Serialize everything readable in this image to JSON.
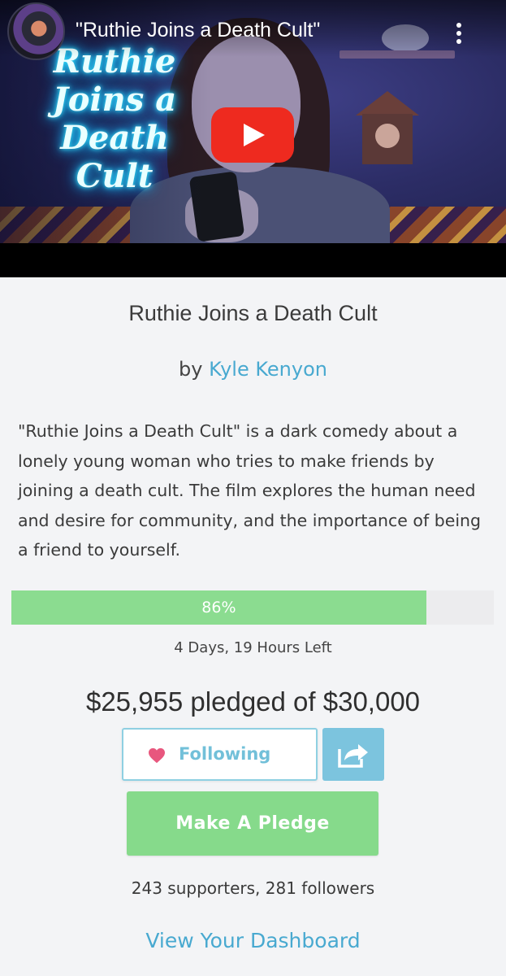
{
  "video": {
    "title": "\"Ruthie Joins a Death Cult\"",
    "thumbnail_title_lines": [
      "Ruthie",
      "Joins a",
      "Death",
      "Cult"
    ],
    "play_button_icon": "youtube-play-icon",
    "menu_icon": "more-vertical-icon"
  },
  "project": {
    "title": "Ruthie Joins a Death Cult",
    "by_prefix": "by",
    "author": "Kyle Kenyon",
    "description": "\"Ruthie Joins a Death Cult\" is a dark comedy about a lonely young woman who tries to make friends by joining a death cult. The film explores the human need and desire for community, and the importance of being a friend to yourself."
  },
  "funding": {
    "percent_label": "86%",
    "percent": 86,
    "time_left": "4 Days, 19 Hours Left",
    "pledged_text": "$25,955 pledged of $30,000",
    "supporters_text": "243 supporters, 281 followers"
  },
  "actions": {
    "following_label": "Following",
    "following_icon": "heart-icon",
    "share_icon": "share-icon",
    "pledge_label": "Make A Pledge",
    "dashboard_link": "View Your Dashboard"
  },
  "colors": {
    "accent_blue": "#48a9d0",
    "progress_green": "#8bdc90",
    "pledge_green": "#86da8b",
    "share_blue": "#7cc4de",
    "heart_pink": "#e8577e",
    "youtube_red": "#ee2a1f"
  }
}
